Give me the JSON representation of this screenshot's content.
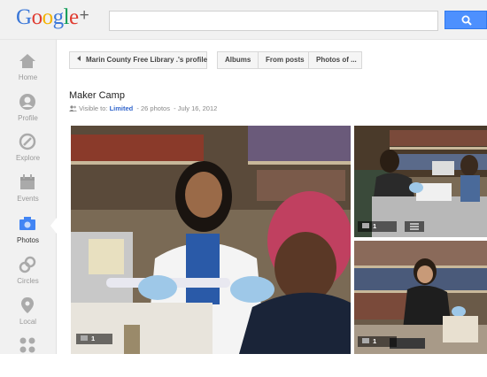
{
  "app": {
    "logo_text": "Google",
    "logo_plus": "+"
  },
  "search": {
    "placeholder": ""
  },
  "sidebar": {
    "items": [
      {
        "label": "Home",
        "icon": "home-icon"
      },
      {
        "label": "Profile",
        "icon": "profile-icon"
      },
      {
        "label": "Explore",
        "icon": "explore-icon"
      },
      {
        "label": "Events",
        "icon": "events-icon"
      },
      {
        "label": "Photos",
        "icon": "photos-icon",
        "active": true
      },
      {
        "label": "Circles",
        "icon": "circles-icon"
      },
      {
        "label": "Local",
        "icon": "local-icon"
      }
    ]
  },
  "toolbar": {
    "back_label": "Marin County Free Library .'s profile",
    "tab_albums": "Albums",
    "tab_from_posts": "From posts",
    "tab_photos_of": "Photos of ..."
  },
  "album": {
    "title": "Maker Camp",
    "visibility_prefix": "Visible to:",
    "visibility_value": "Limited",
    "photo_count": "26 photos",
    "date": "July 16, 2012"
  },
  "photos": [
    {
      "comments": "1"
    },
    {
      "comments": "1"
    },
    {
      "comments": "1"
    }
  ],
  "colors": {
    "accent": "#4d90fe",
    "link": "#3366cc",
    "active_nav": "#4285f4"
  }
}
